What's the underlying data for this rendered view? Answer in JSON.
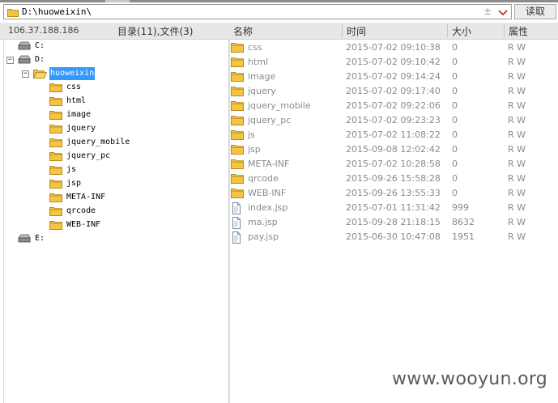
{
  "path_bar": {
    "path": "D:\\huoweixin\\",
    "up_glyph": "±",
    "read_button": "读取"
  },
  "status": {
    "ip": "106.37.188.186",
    "summary": "目录(11),文件(3)"
  },
  "columns": {
    "name": "名称",
    "time": "时间",
    "size": "大小",
    "attr": "属性"
  },
  "tree": {
    "drives": [
      {
        "label": "C:"
      },
      {
        "label": "D:"
      },
      {
        "label": "E:"
      }
    ],
    "current_folder": "huoweixin",
    "children": [
      "css",
      "html",
      "image",
      "jquery",
      "jquery_mobile",
      "jquery_pc",
      "js",
      "jsp",
      "META-INF",
      "qrcode",
      "WEB-INF"
    ]
  },
  "files": [
    {
      "name": "css",
      "time": "2015-07-02 09:10:38",
      "size": "0",
      "attr": "R W",
      "type": "folder"
    },
    {
      "name": "html",
      "time": "2015-07-02 09:10:42",
      "size": "0",
      "attr": "R W",
      "type": "folder"
    },
    {
      "name": "image",
      "time": "2015-07-02 09:14:24",
      "size": "0",
      "attr": "R W",
      "type": "folder"
    },
    {
      "name": "jquery",
      "time": "2015-07-02 09:17:40",
      "size": "0",
      "attr": "R W",
      "type": "folder"
    },
    {
      "name": "jquery_mobile",
      "time": "2015-07-02 09:22:06",
      "size": "0",
      "attr": "R W",
      "type": "folder"
    },
    {
      "name": "jquery_pc",
      "time": "2015-07-02 09:23:23",
      "size": "0",
      "attr": "R W",
      "type": "folder"
    },
    {
      "name": "js",
      "time": "2015-07-02 11:08:22",
      "size": "0",
      "attr": "R W",
      "type": "folder"
    },
    {
      "name": "jsp",
      "time": "2015-09-08 12:02:42",
      "size": "0",
      "attr": "R W",
      "type": "folder"
    },
    {
      "name": "META-INF",
      "time": "2015-07-02 10:28:58",
      "size": "0",
      "attr": "R W",
      "type": "folder"
    },
    {
      "name": "qrcode",
      "time": "2015-09-26 15:58:28",
      "size": "0",
      "attr": "R W",
      "type": "folder"
    },
    {
      "name": "WEB-INF",
      "time": "2015-09-26 13:55:33",
      "size": "0",
      "attr": "R W",
      "type": "folder"
    },
    {
      "name": "index.jsp",
      "time": "2015-07-01 11:31:42",
      "size": "999",
      "attr": "R W",
      "type": "file"
    },
    {
      "name": "ma.jsp",
      "time": "2015-09-28 21:18:15",
      "size": "8632",
      "attr": "R W",
      "type": "file"
    },
    {
      "name": "pay.jsp",
      "time": "2015-06-30 10:47:08",
      "size": "1951",
      "attr": "R W",
      "type": "file"
    }
  ],
  "watermark": "www.wooyun.org",
  "colors": {
    "selection": "#3399ff",
    "folder": "#f5c542",
    "folder_edge": "#b8891a",
    "text_muted": "#8a8a8a"
  }
}
